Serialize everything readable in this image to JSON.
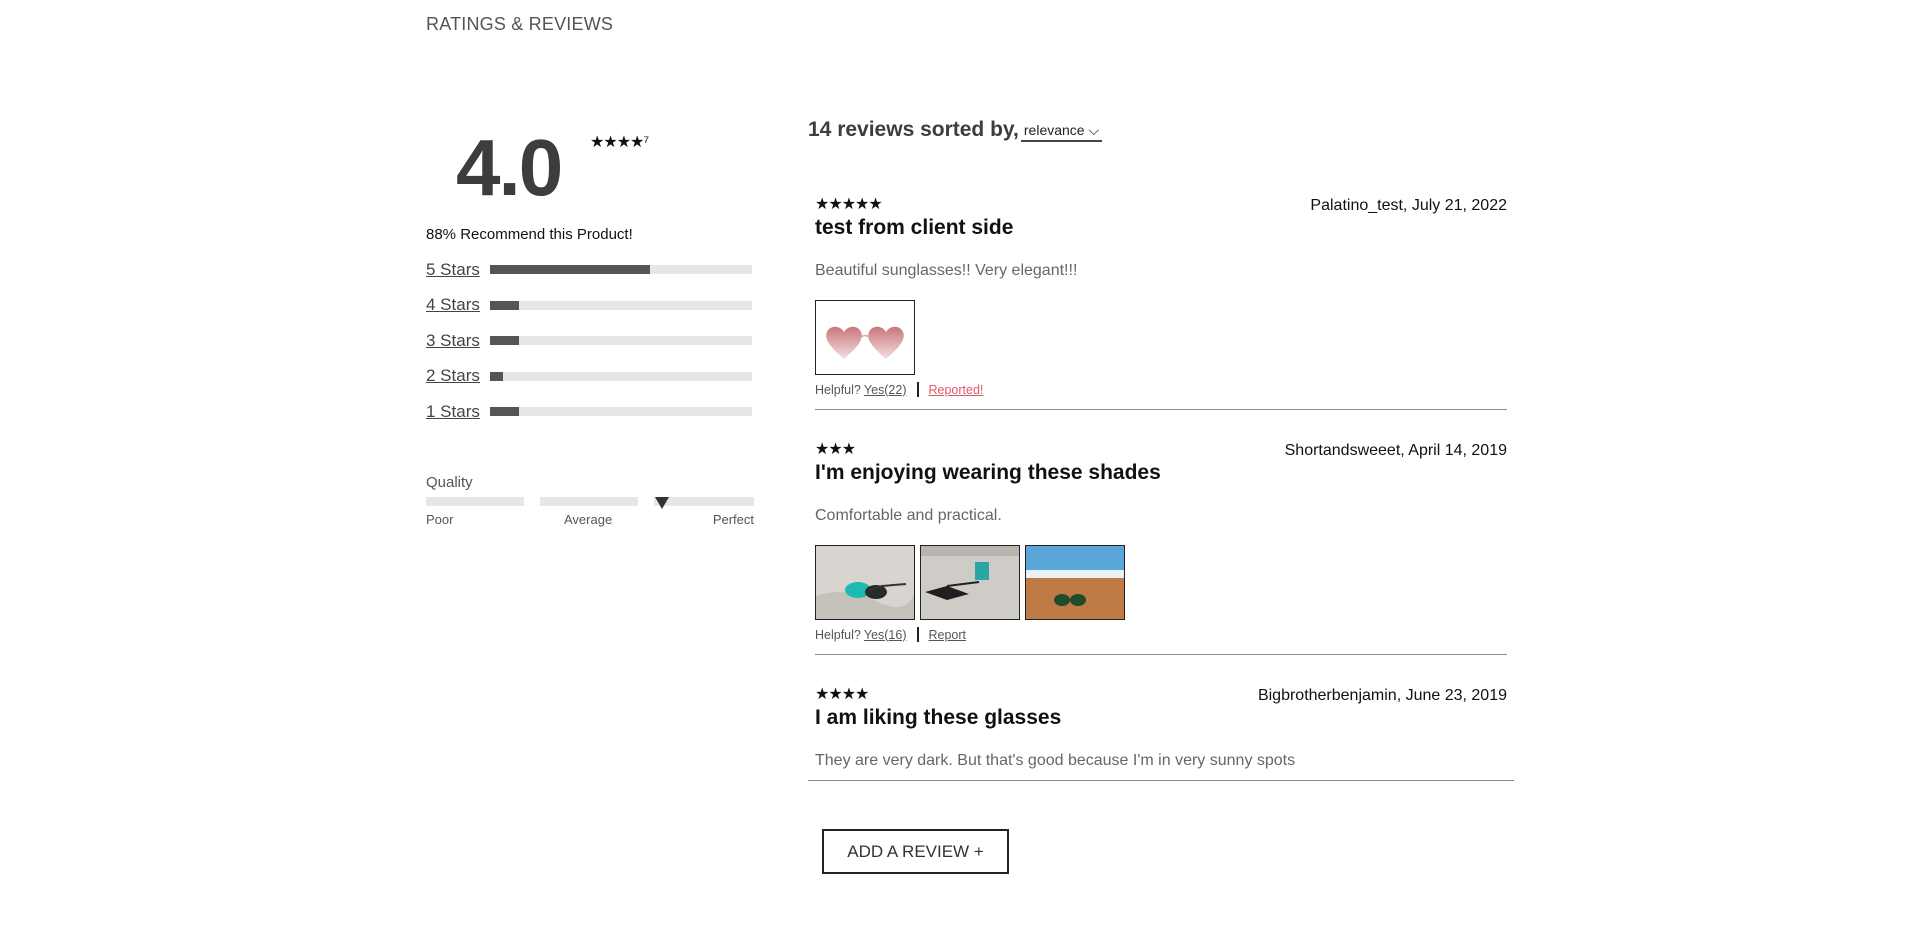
{
  "section_title": "RATINGS & REVIEWS",
  "summary": {
    "average": "4.0",
    "average_stars": "★★★★⁷",
    "average_value": 4.0,
    "recommend": "88% Recommend this Product!",
    "breakdown": [
      {
        "label": "5 Stars",
        "fraction": 0.61
      },
      {
        "label": "4 Stars",
        "fraction": 0.11
      },
      {
        "label": "3 Stars",
        "fraction": 0.11
      },
      {
        "label": "2 Stars",
        "fraction": 0.05
      },
      {
        "label": "1 Stars",
        "fraction": 0.11
      }
    ],
    "factor": {
      "name": "Quality",
      "value": 0.72,
      "labels": {
        "low": "Poor",
        "mid": "Average",
        "high": "Perfect"
      }
    }
  },
  "reviews_header": {
    "text": "14 reviews sorted by,",
    "sort_value": "relevance"
  },
  "reviews": [
    {
      "stars": "★★★★★",
      "rating": 5,
      "meta": "Palatino_test, July 21, 2022",
      "title": "test from client side",
      "body": "Beautiful sunglasses!! Very elegant!!!",
      "helpful_label": "Helpful?",
      "yes_label": "Yes(22)",
      "report_label": "Reported!",
      "photos": [
        "heart-sunglasses-photo"
      ]
    },
    {
      "stars": "★★★",
      "rating": 3,
      "meta": "Shortandsweeet, April 14, 2019",
      "title": "I'm enjoying wearing these shades",
      "body": "Comfortable and practical.",
      "helpful_label": "Helpful?",
      "yes_label": "Yes(16)",
      "report_label": "Report",
      "photos": [
        "teal-sunglasses-photo",
        "black-sunglasses-photo",
        "beach-sunglasses-photo"
      ]
    },
    {
      "stars": "★★★★",
      "rating": 4,
      "meta": "Bigbrotherbenjamin, June 23, 2019",
      "title": "I am liking these glasses",
      "body": "They are very dark. But that's good because I'm in very sunny spots"
    }
  ],
  "add_review_label": "ADD A REVIEW +",
  "colors": {
    "bar_fill": "#555555",
    "bar_track": "#e6e6e6",
    "reported": "#e05a6b",
    "text_dark": "#3d3d3d"
  }
}
